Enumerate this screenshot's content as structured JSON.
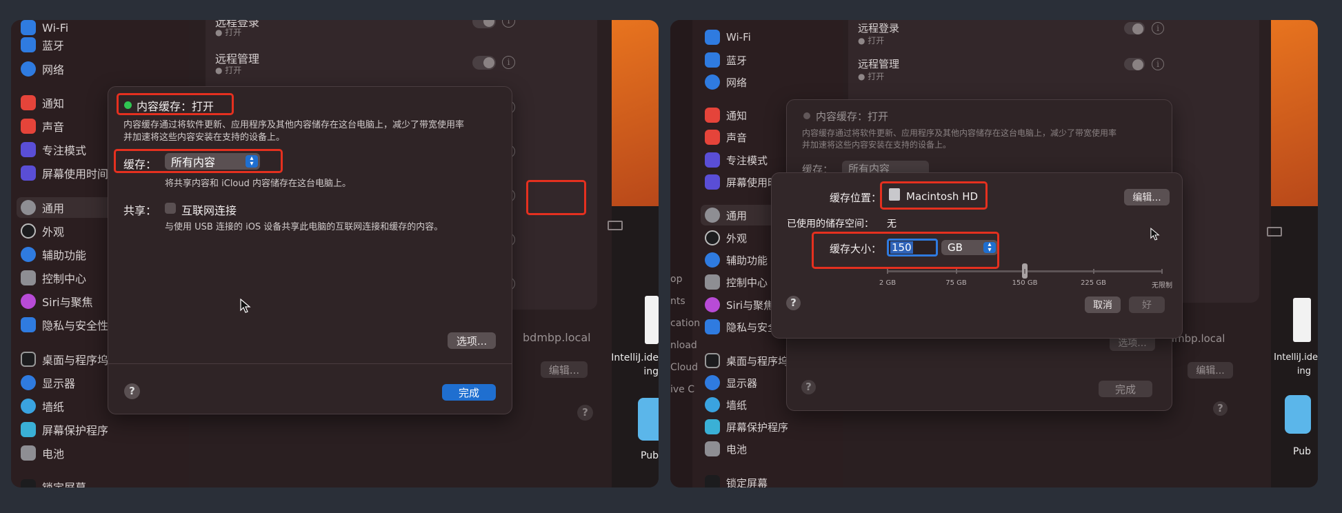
{
  "left": {
    "sidebar": {
      "items": [
        {
          "label": "Wi-Fi",
          "color": "#2f7be0"
        },
        {
          "label": "蓝牙",
          "color": "#2f7be0"
        },
        {
          "label": "网络",
          "color": "#2f7be0"
        },
        {
          "label": "通知",
          "color": "#e5443a"
        },
        {
          "label": "声音",
          "color": "#e5443a"
        },
        {
          "label": "专注模式",
          "color": "#5a4ed6"
        },
        {
          "label": "屏幕使用时间",
          "color": "#5a4ed6"
        },
        {
          "label": "通用",
          "color": "#8e8e93"
        },
        {
          "label": "外观",
          "color": "#1c1c1e"
        },
        {
          "label": "辅助功能",
          "color": "#2f7be0"
        },
        {
          "label": "控制中心",
          "color": "#8e8e93"
        },
        {
          "label": "Siri与聚焦",
          "color": "#b84bd6"
        },
        {
          "label": "隐私与安全性",
          "color": "#2f7be0"
        },
        {
          "label": "桌面与程序坞",
          "color": "#1c1c1e"
        },
        {
          "label": "显示器",
          "color": "#2f7be0"
        },
        {
          "label": "墙纸",
          "color": "#3aa3e0"
        },
        {
          "label": "屏幕保护程序",
          "color": "#3ab0d6"
        },
        {
          "label": "电池",
          "color": "#8e8e93"
        },
        {
          "label": "锁定屏幕",
          "color": "#1c1c1e"
        }
      ]
    },
    "content": {
      "rows": [
        {
          "title": "远程登录",
          "status": "打开"
        },
        {
          "title": "远程管理",
          "status": "打开"
        }
      ],
      "hostname": "bdmbp.local",
      "edit_label": "编辑..."
    },
    "dialog": {
      "status_label": "内容缓存：打开",
      "description_line1": "内容缓存通过将软件更新、应用程序及其他内容储存在这台电脑上，减少了带宽使用率",
      "description_line2": "并加速将这些内容安装在支持的设备上。",
      "cache_label": "缓存：",
      "cache_value": "所有内容",
      "cache_desc": "将共享内容和 iCloud 内容储存在这台电脑上。",
      "share_label": "共享：",
      "share_checkbox_label": "互联网连接",
      "share_desc": "与使用 USB 连接的 iOS 设备共享此电脑的互联网连接和缓存的内容。",
      "options_button": "选项...",
      "done_button": "完成",
      "help": "?"
    }
  },
  "right": {
    "sidebar": {
      "items": [
        {
          "label": "Wi-Fi",
          "color": "#2f7be0"
        },
        {
          "label": "蓝牙",
          "color": "#2f7be0"
        },
        {
          "label": "网络",
          "color": "#2f7be0"
        },
        {
          "label": "通知",
          "color": "#e5443a"
        },
        {
          "label": "声音",
          "color": "#e5443a"
        },
        {
          "label": "专注模式",
          "color": "#5a4ed6"
        },
        {
          "label": "屏幕使用时间",
          "color": "#5a4ed6"
        },
        {
          "label": "通用",
          "color": "#8e8e93"
        },
        {
          "label": "外观",
          "color": "#1c1c1e"
        },
        {
          "label": "辅助功能",
          "color": "#2f7be0"
        },
        {
          "label": "控制中心",
          "color": "#8e8e93"
        },
        {
          "label": "Siri与聚焦",
          "color": "#b84bd6"
        },
        {
          "label": "隐私与安全性",
          "color": "#2f7be0"
        },
        {
          "label": "桌面与程序坞",
          "color": "#1c1c1e"
        },
        {
          "label": "显示器",
          "color": "#2f7be0"
        },
        {
          "label": "墙纸",
          "color": "#3aa3e0"
        },
        {
          "label": "屏幕保护程序",
          "color": "#3ab0d6"
        },
        {
          "label": "电池",
          "color": "#8e8e93"
        },
        {
          "label": "锁定屏幕",
          "color": "#1c1c1e"
        }
      ]
    },
    "content": {
      "rows": [
        {
          "title": "远程登录",
          "status": "打开"
        },
        {
          "title": "远程管理",
          "status": "打开"
        }
      ],
      "hostname": "bdmbp.local",
      "edit_label": "编辑..."
    },
    "back_dialog": {
      "status_label": "内容缓存：打开",
      "description_line1": "内容缓存通过将软件更新、应用程序及其他内容储存在这台电脑上，减少了带宽使用率",
      "description_line2": "并加速将这些内容安装在支持的设备上。",
      "cache_label": "缓存：",
      "cache_value": "所有内容",
      "options_button": "选项...",
      "done_button": "完成",
      "help": "?"
    },
    "options_dialog": {
      "location_label": "缓存位置：",
      "location_value": "Macintosh HD",
      "edit_button": "编辑...",
      "used_label": "已使用的储存空间：",
      "used_value": "无",
      "size_label": "缓存大小：",
      "size_value": "150",
      "unit_value": "GB",
      "slider_ticks": [
        "2 GB",
        "75 GB",
        "150 GB",
        "225 GB",
        "无限制"
      ],
      "slider_value_fraction": 0.5,
      "cancel_button": "取消",
      "ok_button": "好",
      "help": "?"
    },
    "desktop": {
      "app_label_line1": "IntelliJ.ide",
      "app_label_line2": "ing",
      "folder_label": "Pub",
      "partial_labels": [
        "op",
        "nts",
        "cation",
        "nload",
        "Cloud",
        "ive C"
      ]
    }
  },
  "left_desktop": {
    "app_label_line1": "IntelliJ.ide",
    "app_label_line2": "ing",
    "folder_label": "Pub"
  },
  "colors": {
    "highlight": "#e5301f",
    "accent": "#1f6fd0",
    "status_on": "#30c552"
  }
}
